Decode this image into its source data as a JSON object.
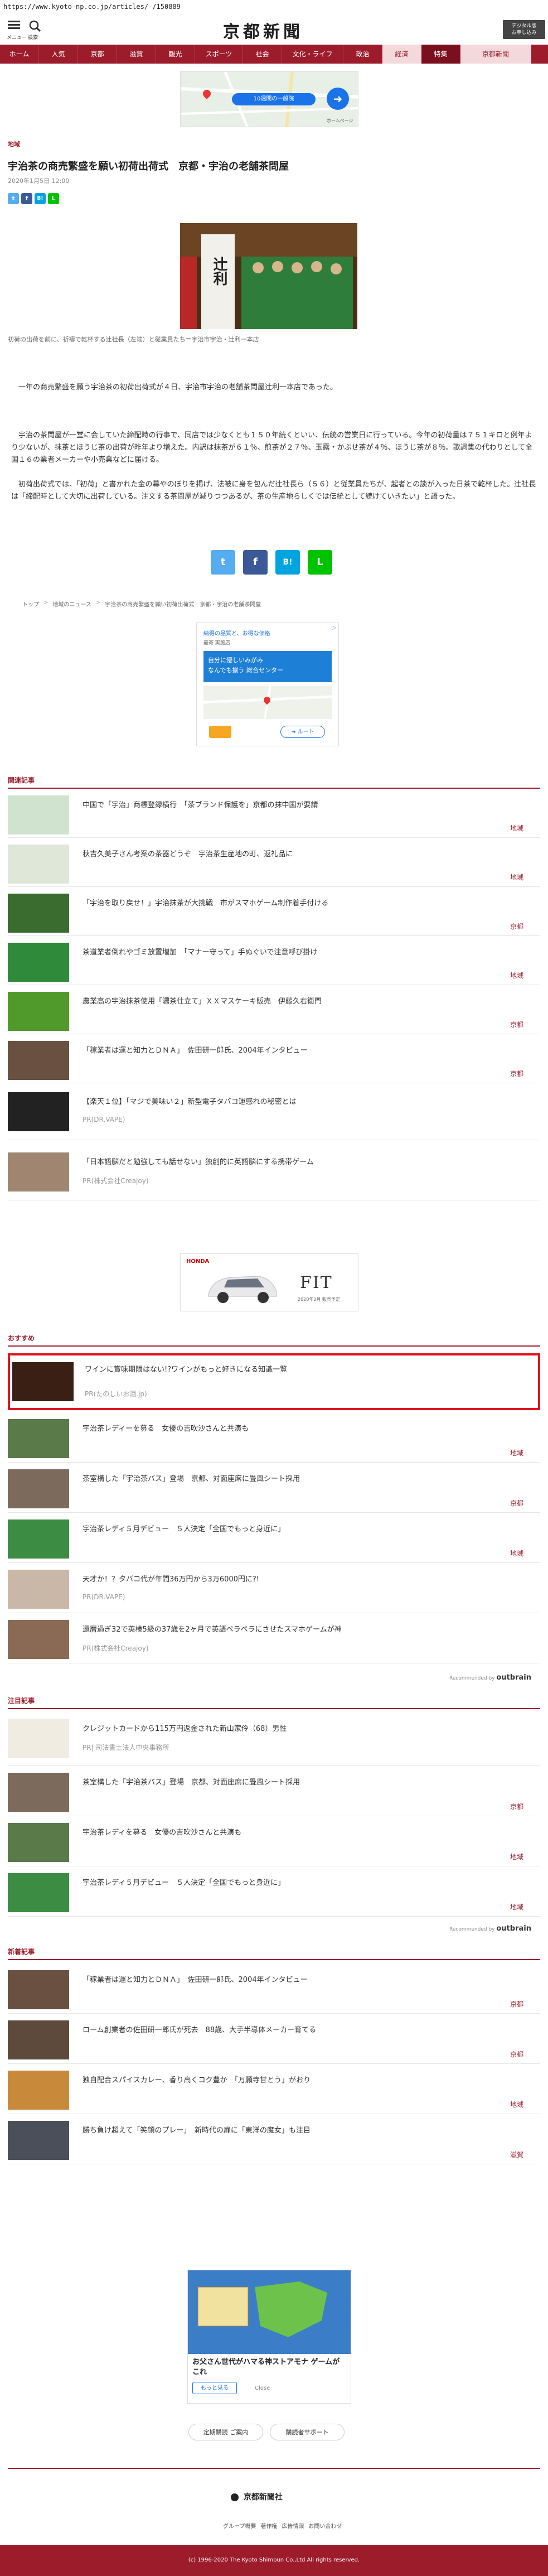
{
  "url": "https://www.kyoto-np.co.jp/articles/-/150889",
  "header": {
    "menu_label": "メニュー",
    "search_label": "検索",
    "logo": "京都新聞",
    "digital_button_line1": "デジタル版",
    "digital_button_line2": "お申し込み"
  },
  "nav": [
    "ホーム",
    "人気",
    "京都",
    "滋賀",
    "観光",
    "スポーツ",
    "社会",
    "文化・ライフ",
    "政治",
    "経済",
    "特集",
    "京都新聞"
  ],
  "ads": {
    "map_top": {
      "label": "10週間の一般院",
      "sub": "ホームページ"
    },
    "fitness": {
      "line1": "納得の品質と、お得な価格",
      "line2": "最寄 実施店",
      "banner": "自分に優しいみがみ",
      "line3": "なんでも揃う 総合センター",
      "route": "ルート"
    },
    "honda": {
      "brand": "HONDA",
      "model": "FIT",
      "caption": "2020年2月 販売予定"
    },
    "game": {
      "title": "お父さん世代がハマる神ストアモナ ゲームがこれ",
      "cta": "もっと見る",
      "close": "Close"
    }
  },
  "article": {
    "section": "地域",
    "title": "宇治茶の商売繁盛を願い初荷出荷式　京都・宇治の老舗茶問屋",
    "date": "2020年1月5日 12:00",
    "share_small": [
      "t",
      "f",
      "B!",
      "L"
    ],
    "photo_caption": "初荷の出荷を前に、祈禱で乾杯する辻社長（左端）と従業員たち＝宇治市宇治・辻利一本店",
    "photo_banner": "辻利",
    "paragraphs": [
      "一年の商売繁盛を願う宇治茶の初荷出荷式が４日、宇治市宇治の老舗茶問屋辻利一本店であった。",
      "宇治の茶問屋が一堂に会していた締配時の行事で、同店では少なくとも１５０年続くといい、伝統の営業日に行っている。今年の初荷量は７５１キロと例年より少ないが、抹茶とほうじ茶の出荷が昨年より増えた。内訳は抹茶が６１％、煎茶が２７％、玉露・かぶせ茶が４％、ほうじ茶が８％。歌詞集の代わりとして全国１６の業者メーカーや小売業などに届ける。",
      "初荷出荷式では、「初荷」と書かれた金の幕やのぼりを掲げ、法被に身を包んだ辻社長ら（５６）と従業員たちが、起者との談が入った日茶で乾杯した。辻社長は「締配時として大切に出荷している。注文する茶問屋が減りつつあるが、茶の生産地らしくでは伝統として続けていきたい」と語った。"
    ],
    "share_large": [
      "t",
      "f",
      "B!",
      "L"
    ]
  },
  "breadcrumb": [
    "トップ",
    "地域のニュース",
    "宇治茶の商売繁盛を願い初荷出荷式　京都・宇治の老舗茶問屋"
  ],
  "related": {
    "heading": "関連記事",
    "items": [
      {
        "title": "中国で「宇治」商標登録横行　「茶ブランド保護を」京都の抹中国が要請",
        "category": "地域"
      },
      {
        "title": "秋吉久美子さん考案の茶器どうぞ　宇治茶生産地の町、返礼品に",
        "category": "地域"
      },
      {
        "title": "「宇治を取り戻せ！」宇治抹茶が大挑戦　市がスマホゲーム制作着手付ける",
        "category": "京都"
      },
      {
        "title": "茶道業者倒れやゴミ放置増加　「マナー守って」手ぬぐいで注意呼び掛け",
        "category": "地域"
      },
      {
        "title": "農業高の宇治抹茶使用「濃茶仕立て」ＸＸマスケーキ販売　伊藤久右衛門",
        "category": "京都"
      },
      {
        "title": "「稼業者は運と知力とＤＮＡ」　佐田研一郎氏、2004年インタビュー",
        "category": "京都"
      },
      {
        "title": "【楽天１位】「マジで美味い２」新型電子タバコ運感れの秘密とは",
        "pr": "PR(DR.VAPE)"
      },
      {
        "title": "「日本語脳だと勉強しても話せない」独創的に英語脳にする携帯ゲーム",
        "pr": "PR(株式会社Creajoy)"
      }
    ]
  },
  "recommended": {
    "heading": "おすすめ",
    "items": [
      {
        "title": "ワインに賞味期限はない!?ワインがもっと好きになる知識一覧",
        "pr": "PR(たのしいお酒.jp)",
        "highlight": true
      },
      {
        "title": "宇治茶レディーを募る　女優の吉吹沙さんと共演も",
        "category": "地域"
      },
      {
        "title": "茶室構した「宇治茶バス」登場　京都、対面座席に畳風シート採用",
        "category": "京都"
      },
      {
        "title": "宇治茶レディ５月デビュー　５人決定「全国でもっと身近に」",
        "category": "地域"
      },
      {
        "title": "天才か！？タバコ代が年間36万円から3万6000円に?!",
        "pr": "PR(DR.VAPE)"
      },
      {
        "title": "還暦過ぎ32で英検5級の37歳を2ヶ月で英語ペラペラにさせたスマホゲームが神",
        "pr": "PR(株式会社Creajoy)"
      }
    ],
    "sponsored_label": "Recommended by",
    "sponsored_brand": "outbrain"
  },
  "featured": {
    "heading": "注目記事",
    "items": [
      {
        "title": "クレジットカードから115万円返金された新山家伶（68）男性",
        "pr": "PR| 司法書士法人中央事務所"
      },
      {
        "title": "茶室構した「宇治茶バス」登場　京都、対面座席に畳風シート採用",
        "category": "京都"
      },
      {
        "title": "宇治茶レディを募る　女優の吉吹沙さんと共演も",
        "category": "地域"
      },
      {
        "title": "宇治茶レディ５月デビュー　５人決定「全国でもっと身近に」",
        "category": "地域"
      }
    ],
    "sponsored_label": "Recommended by",
    "sponsored_brand": "outbrain"
  },
  "latest": {
    "heading": "新着記事",
    "items": [
      {
        "title": "「稼業者は運と知力とＤＮＡ」　佐田研一郎氏、2004年インタビュー",
        "category": "京都"
      },
      {
        "title": "ローム創業者の佐田研一郎氏が死去　88歳、大手半導体メーカー育てる",
        "category": "京都"
      },
      {
        "title": "独自配合スパイスカレー、香り高くコク豊か　「万願寺甘とう」がおり",
        "category": "地域"
      },
      {
        "title": "勝ち負け超えて「笑顔のプレー」　新時代の扉に「東洋の魔女」も注目",
        "category": "滋賀"
      }
    ]
  },
  "footer": {
    "buttons": [
      "定期購読 ご案内",
      "購読者サポート"
    ],
    "logo": "京都新聞社",
    "links": [
      "グループ概要",
      "著作権",
      "広告情報",
      "お問い合わせ"
    ],
    "copyright": "(c) 1996-2020 The Kyoto Shimbun Co.,Ltd All rights reserved."
  },
  "colors": {
    "brand": "#9c1c2c",
    "twitter": "#55acee",
    "facebook": "#3b5998",
    "hatena": "#00a4de",
    "line": "#00c300"
  }
}
